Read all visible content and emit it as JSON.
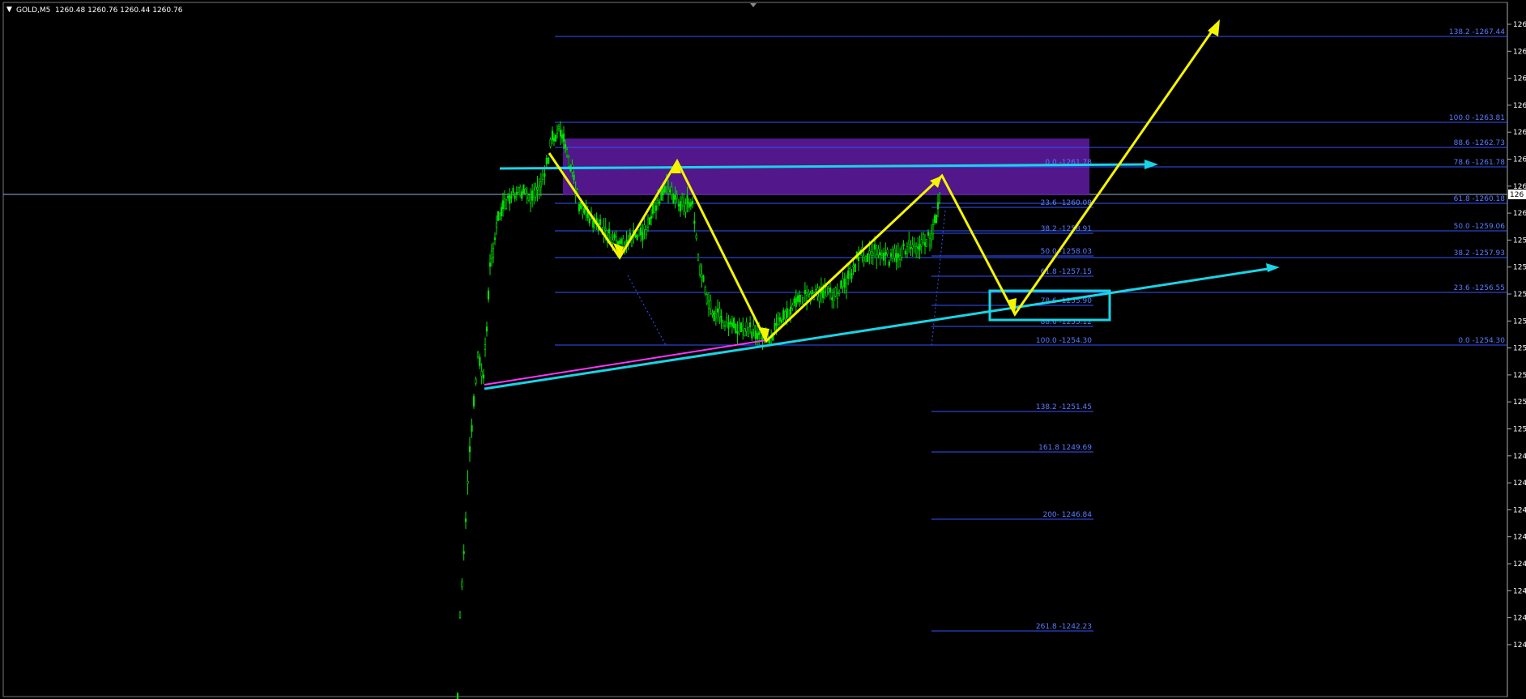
{
  "header": {
    "symbol": "GOLD,M5",
    "ohlc": "1260.48 1260.76 1260.44 1260.76"
  },
  "colors": {
    "background": "#000000",
    "candle": "#00e000",
    "fib": "#3355ff",
    "fib_label": "#5a7cff",
    "cyan": "#19d4e6",
    "yellow": "#f5f500",
    "magenta": "#ff33ff",
    "zone": "#5a1a9a"
  },
  "price_axis": {
    "labels": [
      "126",
      "126",
      "126",
      "126",
      "126",
      "126",
      "126",
      "126",
      "125",
      "125",
      "125",
      "125",
      "125",
      "125",
      "125",
      "125",
      "124",
      "124",
      "124",
      "124",
      "124",
      "124",
      "124",
      "124"
    ],
    "current_price": "126"
  },
  "fib_right": [
    {
      "label": "138.2 -1267.44",
      "price": 1267.44
    },
    {
      "label": "100.0 -1263.81",
      "price": 1263.81
    },
    {
      "label": "88.6 -1262.73",
      "price": 1262.73
    },
    {
      "label": "78.6 -1261.78",
      "price": 1261.78
    },
    {
      "label": "61.8 -1260.18",
      "price": 1260.18
    },
    {
      "label": "50.0 -1259.06",
      "price": 1259.06
    },
    {
      "label": "38.2 -1257.93",
      "price": 1257.93
    },
    {
      "label": "23.6 -1256.55",
      "price": 1256.55
    },
    {
      "label": "0.0 -1254.30",
      "price": 1254.3
    }
  ],
  "fib_inner": [
    {
      "label": "0.0 -1261.78",
      "price": 1261.78
    },
    {
      "label": "23.6 -1260.09",
      "price": 1260.09
    },
    {
      "label": "38.2 -1258.91",
      "price": 1258.91
    },
    {
      "label": "50.0 -1258.03",
      "price": 1258.03
    },
    {
      "label": "61.8 -1257.15",
      "price": 1257.15
    },
    {
      "label": "78.6 -1255.90",
      "price": 1255.9
    },
    {
      "label": "88.6 -1255.12",
      "price": 1255.12
    },
    {
      "label": "100.0 -1254.30",
      "price": 1254.3
    },
    {
      "label": "138.2 -1251.45",
      "price": 1251.45
    },
    {
      "label": "161.8 1249.69",
      "price": 1249.69
    },
    {
      "label": "200- 1246.84",
      "price": 1246.84
    },
    {
      "label": "261.8 -1242.23",
      "price": 1242.23
    }
  ]
}
